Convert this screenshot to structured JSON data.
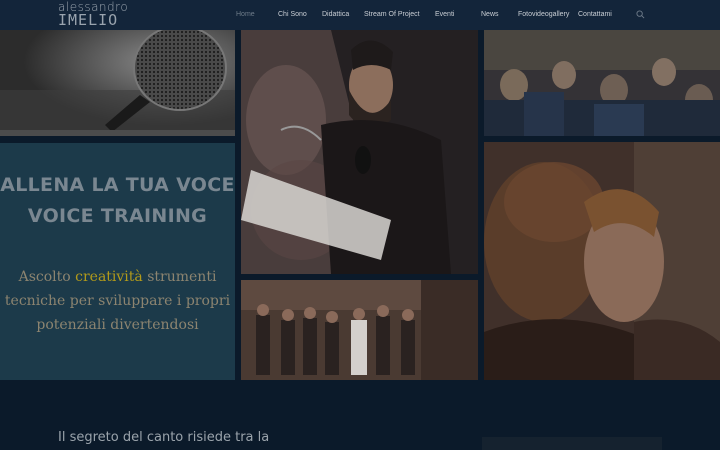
{
  "header": {
    "logo_line1": "alessandro",
    "logo_line2": "IMELIO"
  },
  "nav": {
    "items": [
      {
        "label": "Home",
        "active": true
      },
      {
        "label": "Chi Sono"
      },
      {
        "label": "Didattica"
      },
      {
        "label": "Stream Of Project"
      },
      {
        "label": "Eventi"
      },
      {
        "label": "News"
      },
      {
        "label": "Fotovideogallery"
      },
      {
        "label": "Contattami"
      }
    ],
    "search_icon": "search-icon"
  },
  "panel": {
    "title_line1": "ALLENA LA TUA VOCE",
    "title_line2": "VOICE TRAINING",
    "text_line1_a": "Ascolto ",
    "text_line1_b": "creatività",
    "text_line1_c": " strumenti",
    "text_line2": "tecniche per sviluppare i propri",
    "text_line3": "potenziali divertendosi",
    "highlight_color": "#b29a1a"
  },
  "gallery": {
    "images": [
      "microphone-photo",
      "singer-reading-photo",
      "audience-photo",
      "close-up-faces-photo",
      "group-photo"
    ]
  },
  "bottom": {
    "text": "Il segreto del canto risiede tra la"
  }
}
